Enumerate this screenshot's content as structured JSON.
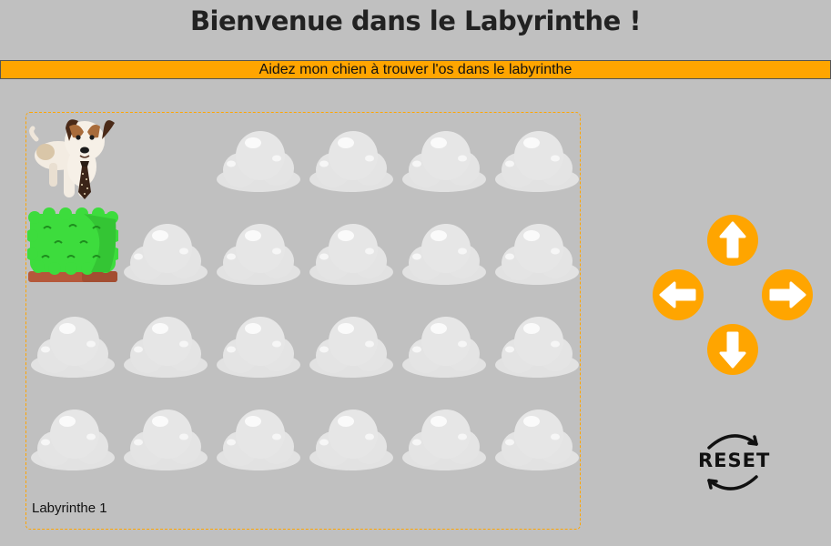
{
  "title": "Bienvenue dans le Labyrinthe !",
  "subtitle": "Aidez mon chien à trouver l'os dans le labyrinthe",
  "maze": {
    "label": "Labyrinthe 1",
    "grid": [
      [
        "dog",
        "empty",
        "cloud",
        "cloud",
        "cloud",
        "cloud"
      ],
      [
        "bush",
        "cloud",
        "cloud",
        "cloud",
        "cloud",
        "cloud"
      ],
      [
        "cloud",
        "cloud",
        "cloud",
        "cloud",
        "cloud",
        "cloud"
      ],
      [
        "cloud",
        "cloud",
        "cloud",
        "cloud",
        "cloud",
        "cloud"
      ]
    ]
  },
  "controls": {
    "up": "arrow-up-icon",
    "left": "arrow-left-icon",
    "right": "arrow-right-icon",
    "down": "arrow-down-icon",
    "reset_label": "RESET"
  },
  "colors": {
    "background": "#c0c0c0",
    "accent": "#ffa500",
    "cloud": "#e4e4e4",
    "bush": "#3ddc3d"
  }
}
